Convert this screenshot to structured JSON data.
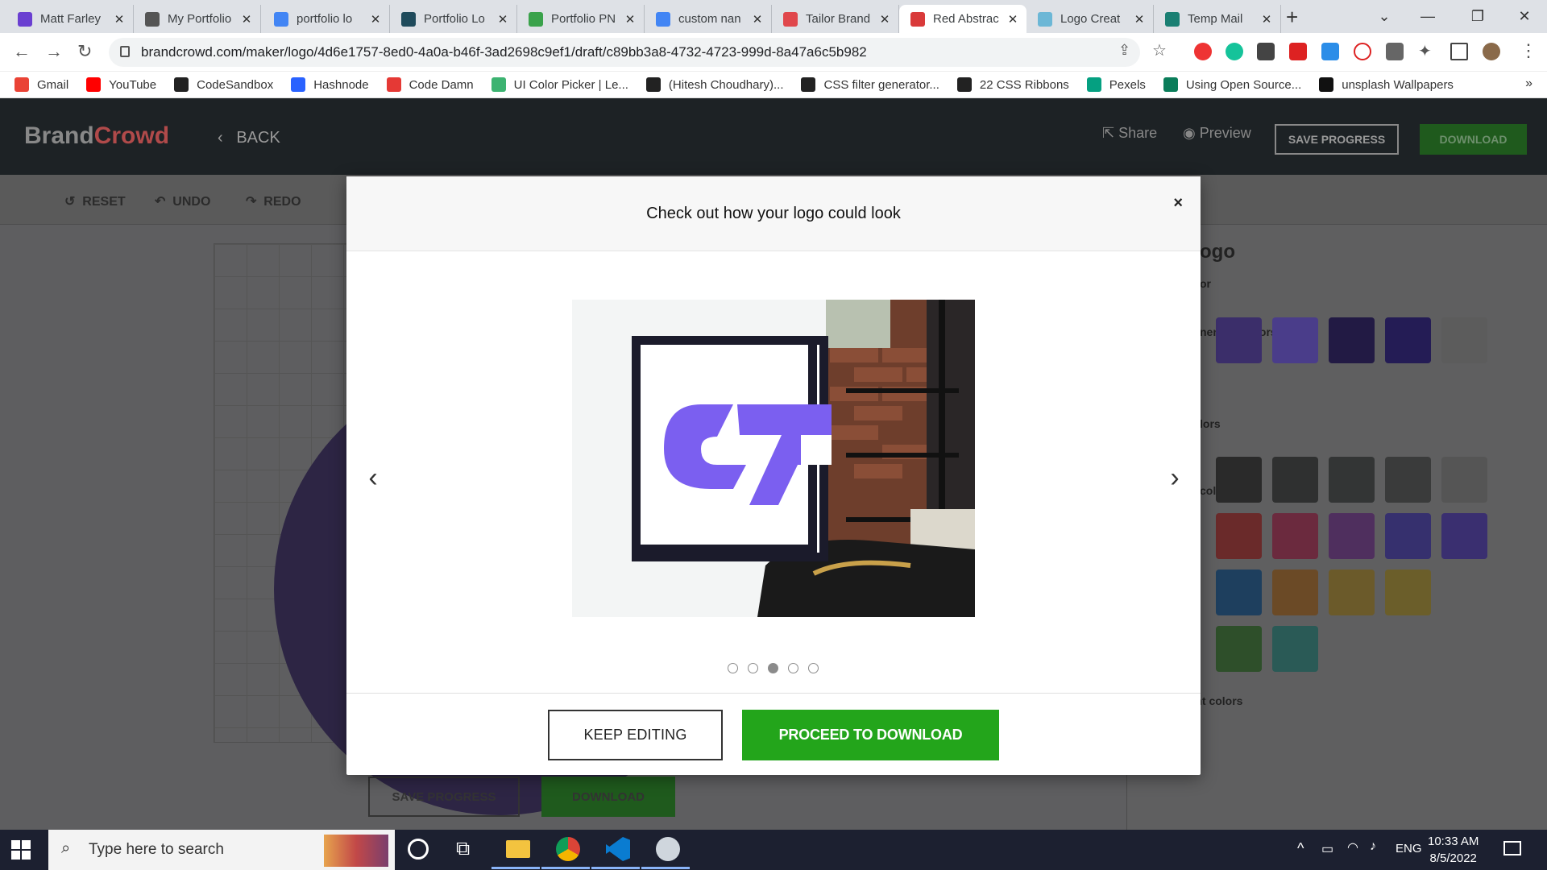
{
  "browser": {
    "tabs": [
      {
        "title": "Matt Farley",
        "favicon_color": "#6a3fd1",
        "active": false
      },
      {
        "title": "My Portfolio",
        "favicon_color": "#555555",
        "active": false
      },
      {
        "title": "portfolio lo",
        "favicon_color": "#4285f4",
        "active": false
      },
      {
        "title": "Portfolio Lo",
        "favicon_color": "#1f4b5c",
        "active": false
      },
      {
        "title": "Portfolio PN",
        "favicon_color": "#3aa24b",
        "active": false
      },
      {
        "title": "custom nan",
        "favicon_color": "#4285f4",
        "active": false
      },
      {
        "title": "Tailor Brand",
        "favicon_color": "#e0474c",
        "active": false
      },
      {
        "title": "Red Abstrac",
        "favicon_color": "#d93a3a",
        "active": true
      },
      {
        "title": "Logo Creat",
        "favicon_color": "#6cb7d6",
        "active": false
      },
      {
        "title": "Temp Mail",
        "favicon_color": "#1a7f73",
        "active": false
      }
    ],
    "url": "brandcrowd.com/maker/logo/4d6e1757-8ed0-4a0a-b46f-3ad2698c9ef1/draft/c89bb3a8-4732-4723-999d-8a47a6c5b982",
    "bookmarks": [
      {
        "label": "Gmail",
        "color": "#ea4335"
      },
      {
        "label": "YouTube",
        "color": "#ff0000"
      },
      {
        "label": "CodeSandbox",
        "color": "#222222"
      },
      {
        "label": "Hashnode",
        "color": "#2962ff"
      },
      {
        "label": "Code Damn",
        "color": "#e53935"
      },
      {
        "label": "UI Color Picker | Le...",
        "color": "#3cb371"
      },
      {
        "label": "(Hitesh Choudhary)...",
        "color": "#222222"
      },
      {
        "label": "CSS filter generator...",
        "color": "#222222"
      },
      {
        "label": "22 CSS Ribbons",
        "color": "#222222"
      },
      {
        "label": "Pexels",
        "color": "#05a081"
      },
      {
        "label": "Using Open Source...",
        "color": "#0a7d5a"
      },
      {
        "label": "unsplash Wallpapers",
        "color": "#111111"
      }
    ],
    "more_bookmarks": "»"
  },
  "app": {
    "brand_part1": "Brand",
    "brand_part2": "Crowd",
    "back_label": "BACK",
    "share_label": "Share",
    "preview_label": "Preview",
    "save_progress_label": "SAVE PROGRESS",
    "download_label": "DOWNLOAD",
    "toolbar": {
      "reset": "RESET",
      "undo": "UNDO",
      "redo": "REDO"
    },
    "panel": {
      "title": "ogo",
      "sections": [
        "or",
        "nended colors",
        "lors",
        "colors",
        "Gradient colors"
      ]
    },
    "bottom": {
      "save_progress": "SAVE PROGRESS",
      "download": "DOWNLOAD"
    }
  },
  "modal": {
    "title": "Check out how your logo could look",
    "close": "×",
    "prev": "‹",
    "next": "›",
    "slides_total": 5,
    "slide_active_index": 2,
    "logo_color": "#7b5ff0",
    "keep_editing": "KEEP EDITING",
    "proceed": "PROCEED TO DOWNLOAD"
  },
  "taskbar": {
    "search_placeholder": "Type here to search",
    "language": "ENG",
    "time": "10:33 AM",
    "date": "8/5/2022"
  }
}
